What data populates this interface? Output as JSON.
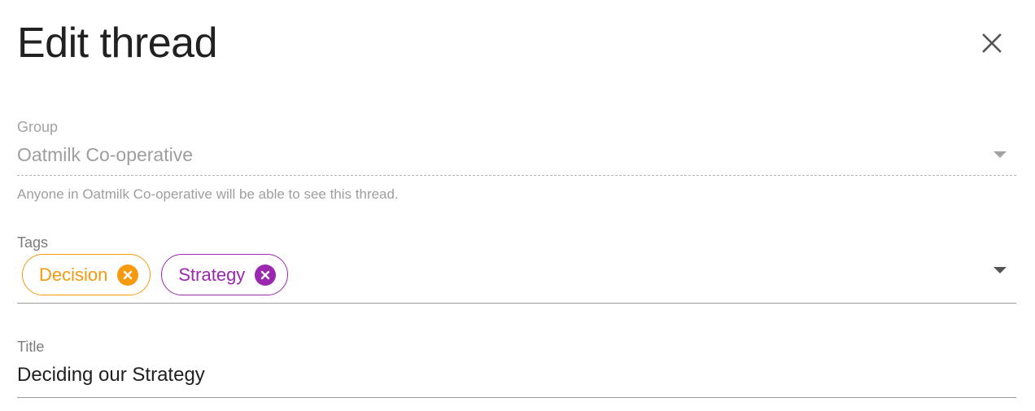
{
  "dialog": {
    "title": "Edit thread"
  },
  "group": {
    "label": "Group",
    "value": "Oatmilk Co-operative",
    "hint": "Anyone in Oatmilk Co-operative will be able to see this thread."
  },
  "tags": {
    "label": "Tags",
    "chips": [
      {
        "label": "Decision",
        "color": "#f59a0f"
      },
      {
        "label": "Strategy",
        "color": "#9c27b0"
      }
    ]
  },
  "title_field": {
    "label": "Title",
    "value": "Deciding our Strategy"
  },
  "icons": {
    "close": "close-icon",
    "dropdown": "chevron-down-icon",
    "chip_remove": "cancel-circle-icon"
  }
}
